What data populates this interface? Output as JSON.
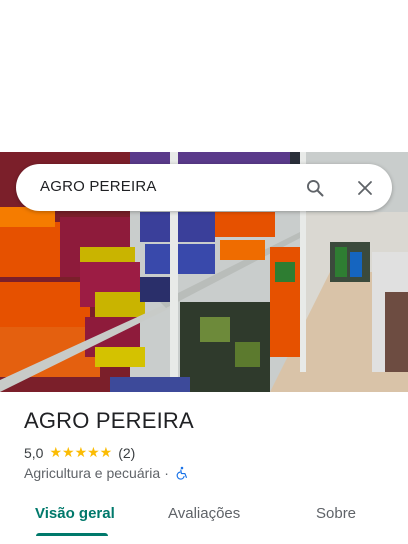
{
  "search": {
    "query": "AGRO PEREIRA"
  },
  "icons": {
    "search": "search-icon",
    "close": "close-icon",
    "accessibility": "wheelchair-icon"
  },
  "place": {
    "name": "AGRO PEREIRA",
    "rating": "5,0",
    "stars": "★★★★★",
    "review_count": "(2)",
    "category": "Agricultura e pecuária",
    "separator": "·"
  },
  "tabs": [
    {
      "label": "Visão geral",
      "active": true
    },
    {
      "label": "Avaliações",
      "active": false
    },
    {
      "label": "Sobre",
      "active": false
    }
  ],
  "colors": {
    "accent": "#00796b",
    "star": "#fbbc04",
    "accessibility": "#1a73e8"
  }
}
